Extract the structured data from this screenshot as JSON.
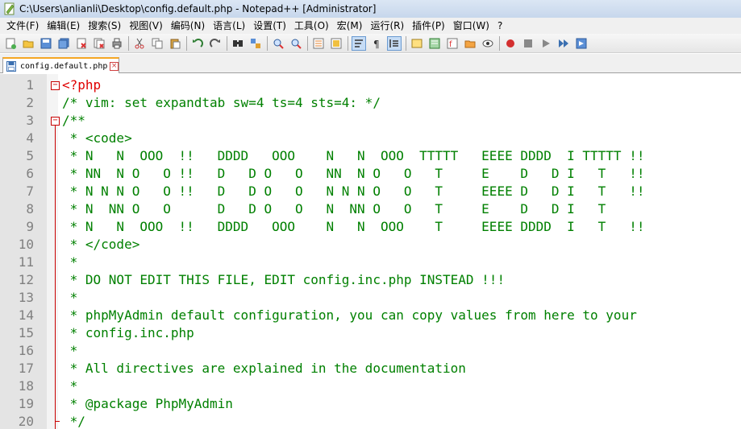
{
  "window": {
    "title": "C:\\Users\\anlianli\\Desktop\\config.default.php - Notepad++ [Administrator]"
  },
  "menu": [
    "文件(F)",
    "编辑(E)",
    "搜索(S)",
    "视图(V)",
    "编码(N)",
    "语言(L)",
    "设置(T)",
    "工具(O)",
    "宏(M)",
    "运行(R)",
    "插件(P)",
    "窗口(W)",
    "?"
  ],
  "toolbar": {
    "icons": [
      "new-file-icon",
      "open-file-icon",
      "save-icon",
      "save-all-icon",
      "close-icon",
      "close-all-icon",
      "print-icon",
      "cut-icon",
      "copy-icon",
      "paste-icon",
      "undo-icon",
      "redo-icon",
      "find-icon",
      "replace-icon",
      "zoom-in-icon",
      "zoom-out-icon",
      "sync-vertical-icon",
      "sync-horizontal-icon",
      "word-wrap-icon",
      "show-all-chars-icon",
      "indent-guide-icon",
      "user-language-icon",
      "document-map-icon",
      "function-list-icon",
      "folder-workspace-icon",
      "monitoring-icon",
      "record-macro-icon",
      "stop-record-icon",
      "play-macro-icon",
      "run-macro-multiple-icon",
      "save-macro-icon"
    ]
  },
  "tab": {
    "label": "config.default.php"
  },
  "editor": {
    "lines": [
      {
        "n": "1",
        "text": "<?php"
      },
      {
        "n": "2",
        "text": "/* vim: set expandtab sw=4 ts=4 sts=4: */"
      },
      {
        "n": "3",
        "text": "/**"
      },
      {
        "n": "4",
        "text": " * <code>"
      },
      {
        "n": "5",
        "text": " * N   N  OOO  !!   DDDD   OOO    N   N  OOO  TTTTT   EEEE DDDD  I TTTTT !!"
      },
      {
        "n": "6",
        "text": " * NN  N O   O !!   D   D O   O   NN  N O   O   T     E    D   D I   T   !!"
      },
      {
        "n": "7",
        "text": " * N N N O   O !!   D   D O   O   N N N O   O   T     EEEE D   D I   T   !!"
      },
      {
        "n": "8",
        "text": " * N  NN O   O      D   D O   O   N  NN O   O   T     E    D   D I   T"
      },
      {
        "n": "9",
        "text": " * N   N  OOO  !!   DDDD   OOO    N   N  OOO    T     EEEE DDDD  I   T   !!"
      },
      {
        "n": "10",
        "text": " * </code>"
      },
      {
        "n": "11",
        "text": " *"
      },
      {
        "n": "12",
        "text": " * DO NOT EDIT THIS FILE, EDIT config.inc.php INSTEAD !!!"
      },
      {
        "n": "13",
        "text": " *"
      },
      {
        "n": "14",
        "text": " * phpMyAdmin default configuration, you can copy values from here to your"
      },
      {
        "n": "15",
        "text": " * config.inc.php"
      },
      {
        "n": "16",
        "text": " *"
      },
      {
        "n": "17",
        "text": " * All directives are explained in the documentation"
      },
      {
        "n": "18",
        "text": " *"
      },
      {
        "n": "19",
        "text": " * @package PhpMyAdmin"
      },
      {
        "n": "20",
        "text": " */"
      }
    ],
    "fold_open_glyph": "−",
    "colors": {
      "comment": "#008000",
      "php_tag": "#e00000",
      "line_number": "#808080",
      "fold_marker": "#c80000"
    }
  }
}
